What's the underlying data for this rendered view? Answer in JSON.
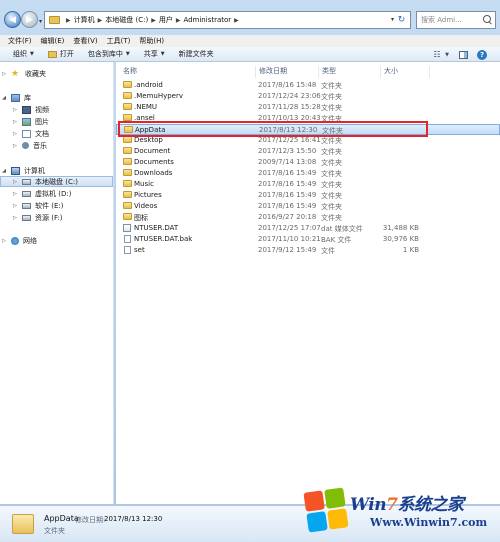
{
  "address_bar": {
    "crumbs": [
      "计算机",
      "本地磁盘 (C:)",
      "用户",
      "Administrator"
    ]
  },
  "search": {
    "placeholder": "搜索 Admi..."
  },
  "menu": [
    "文件(F)",
    "编辑(E)",
    "查看(V)",
    "工具(T)",
    "帮助(H)"
  ],
  "commands": {
    "organize": "组织",
    "open": "打开",
    "include_in_library": "包含到库中",
    "share": "共享",
    "new_folder": "新建文件夹"
  },
  "nav": {
    "favorites": "收藏夹",
    "libraries": "库",
    "lib_items": [
      "视频",
      "图片",
      "文档",
      "音乐"
    ],
    "computer": "计算机",
    "drives": [
      "本地磁盘 (C:)",
      "虚拟机 (D:)",
      "软件 (E:)",
      "资源 (F:)"
    ],
    "network": "网络"
  },
  "columns": {
    "name": "名称",
    "date": "修改日期",
    "type": "类型",
    "size": "大小"
  },
  "files": [
    {
      "name": ".android",
      "date": "2017/8/16 15:48",
      "type": "文件夹",
      "size": "",
      "kind": "folder"
    },
    {
      "name": ".MemuHyperv",
      "date": "2017/12/24 23:06",
      "type": "文件夹",
      "size": "",
      "kind": "folder"
    },
    {
      "name": ".NEMU",
      "date": "2017/11/28 15:28",
      "type": "文件夹",
      "size": "",
      "kind": "folder"
    },
    {
      "name": ".ansel",
      "date": "2017/10/13 20:43",
      "type": "文件夹",
      "size": "",
      "kind": "folder"
    },
    {
      "name": "AppData",
      "date": "2017/8/13 12:30",
      "type": "文件夹",
      "size": "",
      "kind": "folder",
      "highlighted": true
    },
    {
      "name": "Desktop",
      "date": "2017/12/25 16:41",
      "type": "文件夹",
      "size": "",
      "kind": "folder"
    },
    {
      "name": "Document",
      "date": "2017/12/3 15:50",
      "type": "文件夹",
      "size": "",
      "kind": "folder"
    },
    {
      "name": "Documents",
      "date": "2009/7/14 13:08",
      "type": "文件夹",
      "size": "",
      "kind": "folder"
    },
    {
      "name": "Downloads",
      "date": "2017/8/16 15:49",
      "type": "文件夹",
      "size": "",
      "kind": "folder"
    },
    {
      "name": "Music",
      "date": "2017/8/16 15:49",
      "type": "文件夹",
      "size": "",
      "kind": "folder"
    },
    {
      "name": "Pictures",
      "date": "2017/8/16 15:49",
      "type": "文件夹",
      "size": "",
      "kind": "folder"
    },
    {
      "name": "Videos",
      "date": "2017/8/16 15:49",
      "type": "文件夹",
      "size": "",
      "kind": "folder"
    },
    {
      "name": "图标",
      "date": "2016/9/27 20:18",
      "type": "文件夹",
      "size": "",
      "kind": "folder"
    },
    {
      "name": "NTUSER.DAT",
      "date": "2017/12/25 17:07",
      "type": "dat 媒体文件",
      "size": "31,488 KB",
      "kind": "sys"
    },
    {
      "name": "NTUSER.DAT.bak",
      "date": "2017/11/10 10:21",
      "type": "BAK 文件",
      "size": "30,976 KB",
      "kind": "file"
    },
    {
      "name": "set",
      "date": "2017/9/12 15:49",
      "type": "文件",
      "size": "1 KB",
      "kind": "file"
    }
  ],
  "details": {
    "name": "AppData",
    "modified_label": "修改日期:",
    "modified_value": "2017/8/13 12:30",
    "type": "文件夹"
  },
  "watermark": {
    "title_a": "Win",
    "title_7": "7",
    "title_b": "系统之家",
    "url": "Www.Winwin7.com"
  },
  "colors": {
    "highlight_box": "#e0262c",
    "selection": "#c4dcf5",
    "folder": "#e8bf4c"
  }
}
